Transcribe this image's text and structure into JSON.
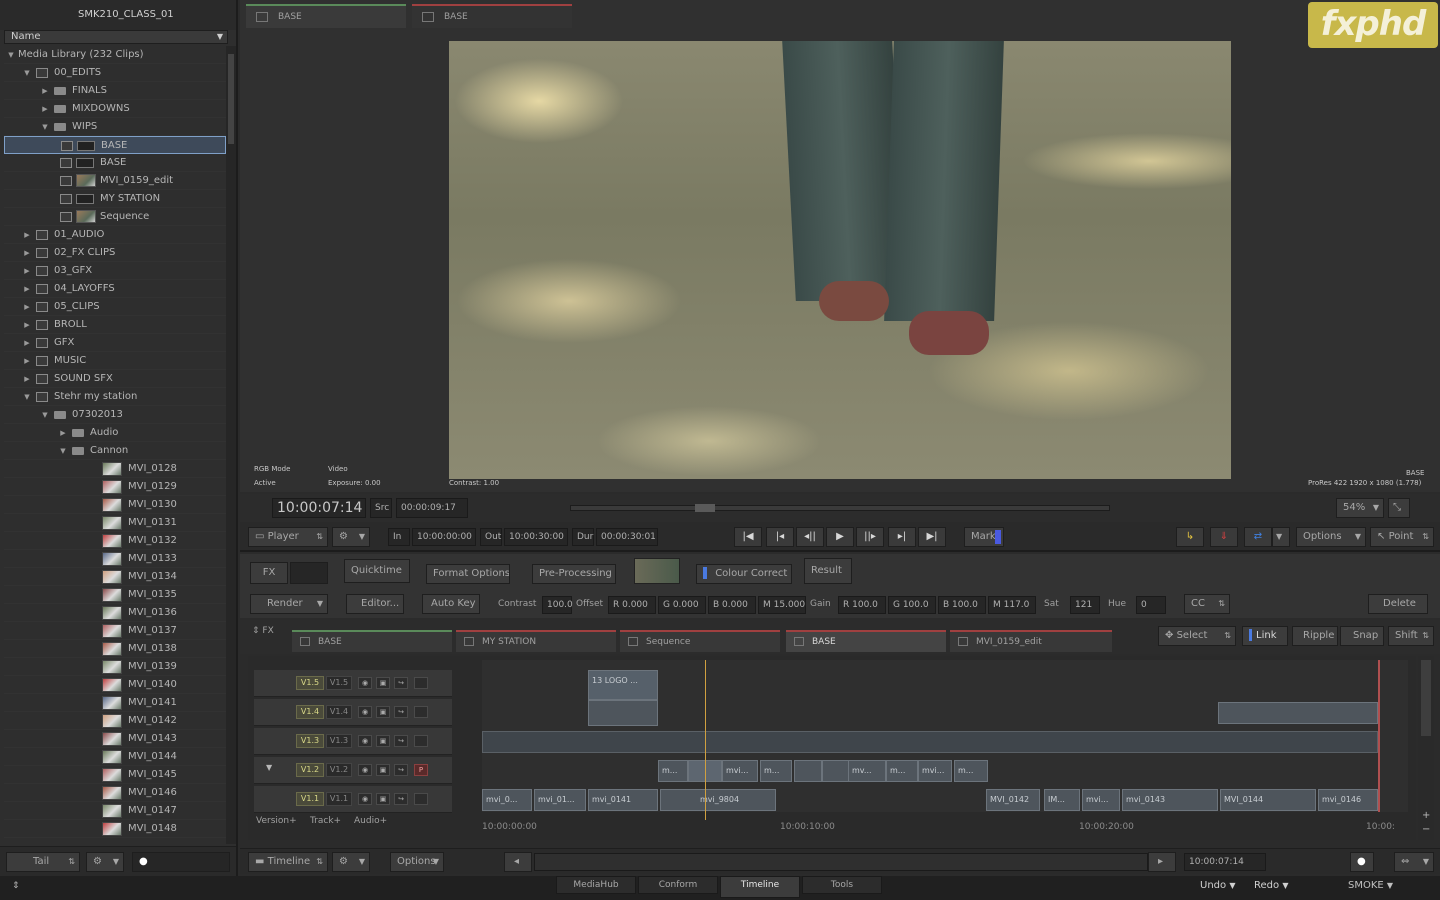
{
  "library": {
    "title": "SMK210_CLASS_01",
    "column": "Name",
    "root": "Media Library (232 Clips)",
    "items": [
      {
        "label": "00_EDITS",
        "depth": 1,
        "icon": "library",
        "open": true
      },
      {
        "label": "FINALS",
        "depth": 2,
        "icon": "folder",
        "open": false
      },
      {
        "label": "MIXDOWNS",
        "depth": 2,
        "icon": "folder",
        "open": false
      },
      {
        "label": "WIPS",
        "depth": 2,
        "icon": "folder",
        "open": true
      },
      {
        "label": "BASE",
        "depth": 3,
        "icon": "sequence",
        "selected": true
      },
      {
        "label": "BASE",
        "depth": 3,
        "icon": "sequence"
      },
      {
        "label": "MVI_0159_edit",
        "depth": 3,
        "icon": "clip"
      },
      {
        "label": "MY STATION",
        "depth": 3,
        "icon": "sequence"
      },
      {
        "label": "Sequence",
        "depth": 3,
        "icon": "clip"
      },
      {
        "label": "01_AUDIO",
        "depth": 1,
        "icon": "library"
      },
      {
        "label": "02_FX CLIPS",
        "depth": 1,
        "icon": "library"
      },
      {
        "label": "03_GFX",
        "depth": 1,
        "icon": "library"
      },
      {
        "label": "04_LAYOFFS",
        "depth": 1,
        "icon": "library"
      },
      {
        "label": "05_CLIPS",
        "depth": 1,
        "icon": "library"
      },
      {
        "label": "BROLL",
        "depth": 1,
        "icon": "library"
      },
      {
        "label": "GFX",
        "depth": 1,
        "icon": "library"
      },
      {
        "label": "MUSIC",
        "depth": 1,
        "icon": "library"
      },
      {
        "label": "SOUND SFX",
        "depth": 1,
        "icon": "library"
      },
      {
        "label": "Stehr my station",
        "depth": 1,
        "icon": "library",
        "open": true
      },
      {
        "label": "07302013",
        "depth": 2,
        "icon": "folder",
        "open": true
      },
      {
        "label": "Audio",
        "depth": 3,
        "icon": "folder"
      },
      {
        "label": "Cannon",
        "depth": 3,
        "icon": "folder",
        "open": true
      },
      {
        "label": "MVI_0128",
        "depth": 4,
        "icon": "thumb"
      },
      {
        "label": "MVI_0129",
        "depth": 4,
        "icon": "thumb"
      },
      {
        "label": "MVI_0130",
        "depth": 4,
        "icon": "thumb"
      },
      {
        "label": "MVI_0131",
        "depth": 4,
        "icon": "thumb"
      },
      {
        "label": "MVI_0132",
        "depth": 4,
        "icon": "thumb"
      },
      {
        "label": "MVI_0133",
        "depth": 4,
        "icon": "thumb"
      },
      {
        "label": "MVI_0134",
        "depth": 4,
        "icon": "thumb"
      },
      {
        "label": "MVI_0135",
        "depth": 4,
        "icon": "thumb"
      },
      {
        "label": "MVI_0136",
        "depth": 4,
        "icon": "thumb"
      },
      {
        "label": "MVI_0137",
        "depth": 4,
        "icon": "thumb"
      },
      {
        "label": "MVI_0138",
        "depth": 4,
        "icon": "thumb"
      },
      {
        "label": "MVI_0139",
        "depth": 4,
        "icon": "thumb"
      },
      {
        "label": "MVI_0140",
        "depth": 4,
        "icon": "thumb"
      },
      {
        "label": "MVI_0141",
        "depth": 4,
        "icon": "thumb"
      },
      {
        "label": "MVI_0142",
        "depth": 4,
        "icon": "thumb"
      },
      {
        "label": "MVI_0143",
        "depth": 4,
        "icon": "thumb"
      },
      {
        "label": "MVI_0144",
        "depth": 4,
        "icon": "thumb"
      },
      {
        "label": "MVI_0145",
        "depth": 4,
        "icon": "thumb"
      },
      {
        "label": "MVI_0146",
        "depth": 4,
        "icon": "thumb"
      },
      {
        "label": "MVI_0147",
        "depth": 4,
        "icon": "thumb"
      },
      {
        "label": "MVI_0148",
        "depth": 4,
        "icon": "thumb"
      }
    ],
    "bottom": {
      "mode": "Tail"
    }
  },
  "viewer": {
    "tabs": [
      "BASE",
      "BASE"
    ],
    "overlay": {
      "rgb_mode": "RGB Mode",
      "active": "Active",
      "video": "Video",
      "exposure": "Exposure: 0.00",
      "contrast": "Contrast: 1.00",
      "clip_name": "BASE",
      "format": "ProRes 422 1920 x 1080 (1.778)"
    },
    "logo": "fxphd"
  },
  "transport": {
    "timecode": "10:00:07:14",
    "src_label": "Src",
    "src_tc": "00:00:09:17",
    "zoom": "54%",
    "player": "Player",
    "in_label": "In",
    "in_tc": "10:00:00:00",
    "out_label": "Out",
    "out_tc": "10:00:30:00",
    "dur_label": "Dur",
    "dur_tc": "00:00:30:01",
    "mark": "Mark",
    "options": "Options",
    "point": "Point"
  },
  "fx": {
    "fx_btn": "FX",
    "pipeline": [
      "Quicktime",
      "Format Options",
      "Pre-Processing",
      "Colour Correct",
      "Result"
    ],
    "render": "Render",
    "editor": "Editor...",
    "auto_key": "Auto Key",
    "contrast_label": "Contrast",
    "contrast": "100.0",
    "offset_label": "Offset",
    "r_offset": "R 0.000",
    "g_offset": "G 0.000",
    "b_offset": "B 0.000",
    "m_offset": "M 15.000",
    "gain_label": "Gain",
    "r_gain": "R 100.0",
    "g_gain": "G 100.0",
    "b_gain": "B 100.0",
    "m_gain": "M 117.0",
    "sat_label": "Sat",
    "sat": "121",
    "hue_label": "Hue",
    "hue": "0",
    "cc": "CC",
    "delete": "Delete"
  },
  "timeline_tabs": {
    "fx_toggle": "FX",
    "tabs": [
      "BASE",
      "MY STATION",
      "Sequence",
      "BASE",
      "MVI_0159_edit"
    ],
    "tools": [
      "Select",
      "Link",
      "Ripple",
      "Snap",
      "Shift"
    ]
  },
  "tracks": [
    {
      "name": "V1.5",
      "alt": "V1.5"
    },
    {
      "name": "V1.4",
      "alt": "V1.4"
    },
    {
      "name": "V1.3",
      "alt": "V1.3"
    },
    {
      "name": "V1.2",
      "alt": "V1.2"
    },
    {
      "name": "V1.1",
      "alt": "V1.1"
    }
  ],
  "segments": {
    "logo": "13 LOGO ...",
    "v12": [
      "m...",
      "",
      "mvi...",
      "m...",
      "",
      "",
      "mv...",
      "m...",
      "mvi...",
      "m..."
    ],
    "v11": [
      "mvi_0...",
      "mvi_01...",
      "mvi_0141",
      "mvi_9804",
      "MVI_0142",
      "IM...",
      "mvi...",
      "mvi_0143",
      "MVI_0144",
      "mvi_0146"
    ]
  },
  "track_footer": [
    "Version+",
    "Track+",
    "Audio+"
  ],
  "ruler": [
    "10:00:00:00",
    "10:00:10:00",
    "10:00:20:00",
    "10:00:"
  ],
  "bottom": {
    "timeline": "Timeline",
    "options": "Options",
    "timecode": "10:00:07:14"
  },
  "status": {
    "tabs": [
      "MediaHub",
      "Conform",
      "Timeline",
      "Tools"
    ],
    "undo": "Undo",
    "redo": "Redo",
    "app": "SMOKE"
  }
}
